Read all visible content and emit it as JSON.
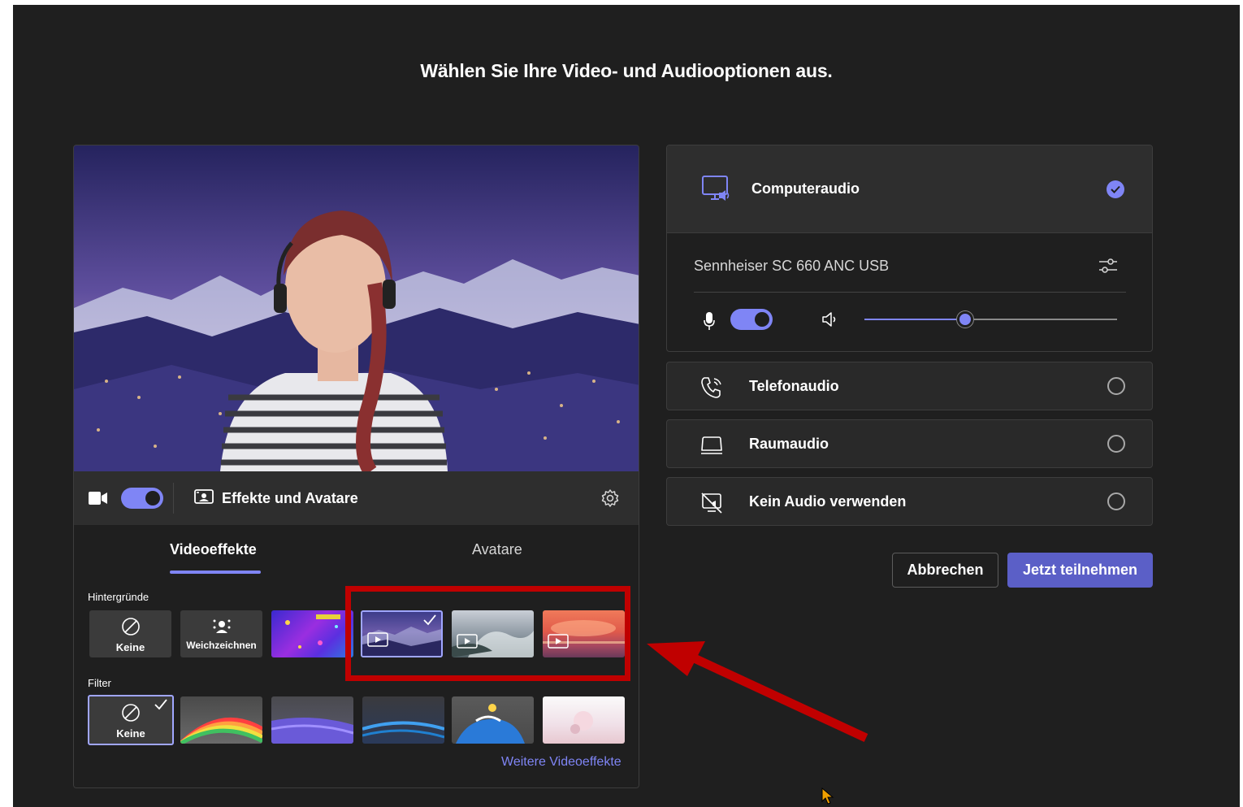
{
  "title": "Wählen Sie Ihre Video- und Audiooptionen aus.",
  "video_bar": {
    "camera_on": true,
    "effects_label": "Effekte und Avatare"
  },
  "tabs": [
    {
      "label": "Videoeffekte",
      "selected": true
    },
    {
      "label": "Avatare",
      "selected": false
    }
  ],
  "backgrounds": {
    "label": "Hintergründe",
    "items": [
      {
        "label": "Keine",
        "icon": "none-icon",
        "selected": false
      },
      {
        "label": "Weichzeichnen",
        "icon": "blur-icon",
        "selected": false
      },
      {
        "label": "",
        "icon": "",
        "selected": false
      },
      {
        "label": "",
        "icon": "video-play-icon",
        "selected": true
      },
      {
        "label": "",
        "icon": "video-play-icon",
        "selected": false
      },
      {
        "label": "",
        "icon": "video-play-icon",
        "selected": false
      }
    ]
  },
  "filters": {
    "label": "Filter",
    "items": [
      {
        "label": "Keine",
        "icon": "none-icon",
        "selected": true
      },
      {
        "label": "",
        "selected": false
      },
      {
        "label": "",
        "selected": false
      },
      {
        "label": "",
        "selected": false
      },
      {
        "label": "",
        "selected": false
      },
      {
        "label": "",
        "selected": false
      }
    ]
  },
  "more_effects_link": "Weitere Videoeffekte",
  "audio": {
    "computer": {
      "label": "Computeraudio",
      "selected": true,
      "device": "Sennheiser SC 660 ANC USB",
      "mic_on": true,
      "volume_fraction": 0.4
    },
    "options": [
      {
        "label": "Telefonaudio",
        "icon": "phone-icon",
        "selected": false
      },
      {
        "label": "Raumaudio",
        "icon": "room-icon",
        "selected": false
      },
      {
        "label": "Kein Audio verwenden",
        "icon": "no-audio-icon",
        "selected": false
      }
    ]
  },
  "buttons": {
    "cancel": "Abbrechen",
    "join": "Jetzt teilnehmen"
  },
  "colors": {
    "accent": "#7f85f5",
    "primary_button": "#5b5fc7",
    "background": "#1f1f1f",
    "annotation": "#c00000"
  }
}
